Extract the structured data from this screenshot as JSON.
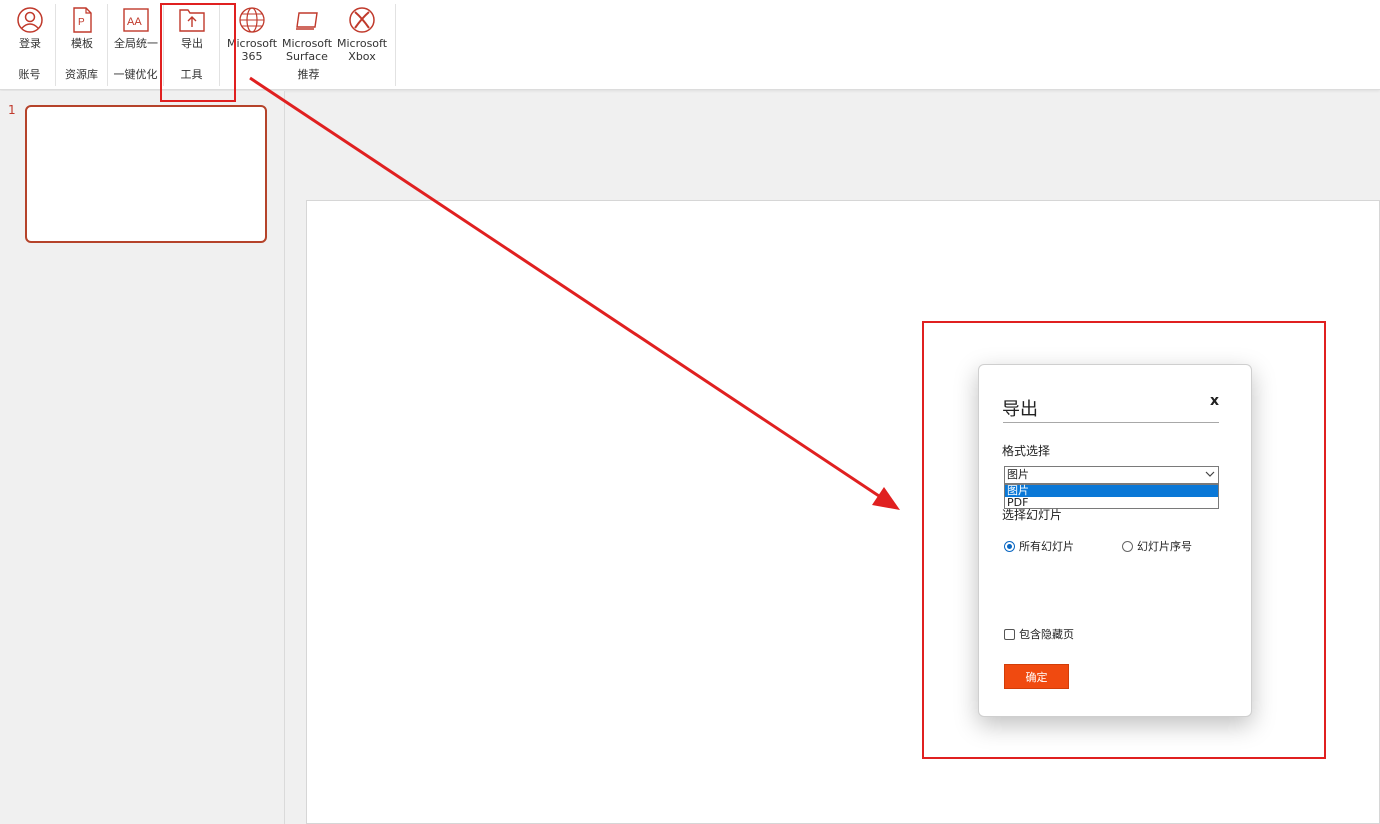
{
  "ribbon": {
    "groups": [
      {
        "label": "账号",
        "buttons": [
          {
            "label": "登录",
            "icon": "user-icon"
          }
        ]
      },
      {
        "label": "资源库",
        "buttons": [
          {
            "label": "模板",
            "icon": "template-icon"
          }
        ]
      },
      {
        "label": "一键优化",
        "buttons": [
          {
            "label": "全局统一",
            "icon": "font-unify-icon"
          }
        ]
      },
      {
        "label": "工具",
        "buttons": [
          {
            "label": "导出",
            "icon": "export-icon"
          }
        ]
      },
      {
        "label": "推荐",
        "buttons": [
          {
            "label": "Microsoft\n365",
            "line1": "Microsoft",
            "line2": "365",
            "icon": "globe-icon"
          },
          {
            "label": "Microsoft\nSurface",
            "line1": "Microsoft",
            "line2": "Surface",
            "icon": "surface-icon"
          },
          {
            "label": "Microsoft\nXbox",
            "line1": "Microsoft",
            "line2": "Xbox",
            "icon": "xbox-icon"
          }
        ]
      }
    ]
  },
  "thumbnails": [
    {
      "number": "1"
    }
  ],
  "dialog": {
    "title": "导出",
    "close": "x",
    "format_label": "格式选择",
    "format_selected": "图片",
    "format_options": [
      "图片",
      "PDF"
    ],
    "slides_label": "选择幻灯片",
    "radio_all": "所有幻灯片",
    "radio_number": "幻灯片序号",
    "include_hidden": "包含隐藏页",
    "ok": "确定"
  },
  "colors": {
    "accent": "#f04a10",
    "icon": "#c0392b",
    "annotation": "#e02020",
    "dropdown_highlight": "#0a78d7"
  }
}
